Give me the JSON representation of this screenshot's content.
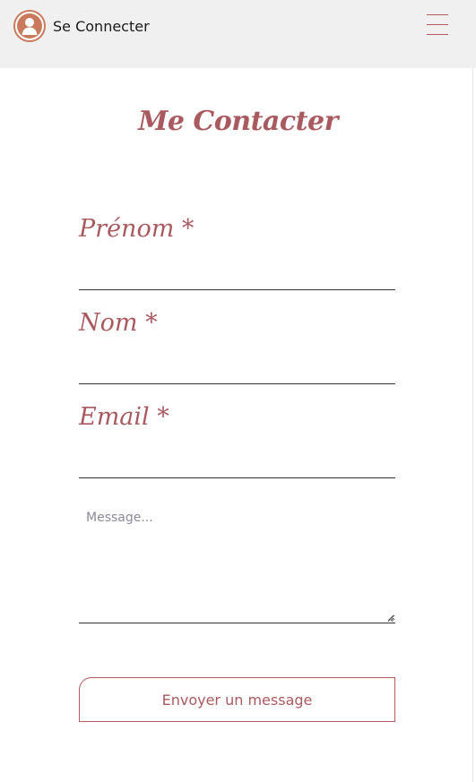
{
  "header": {
    "login_label": "Se Connecter",
    "avatar_icon": "user-circle-icon",
    "menu_icon": "hamburger-menu-icon",
    "accent_color": "#c97a5c",
    "menu_color": "#b55a5e"
  },
  "page": {
    "title": "Me Contacter",
    "brand_color": "#a85a5f"
  },
  "form": {
    "first_name_label": "Prénom *",
    "first_name_value": "",
    "last_name_label": "Nom *",
    "last_name_value": "",
    "email_label": "Email *",
    "email_value": "",
    "message_placeholder": "Message...",
    "message_value": "",
    "submit_label": "Envoyer un message"
  }
}
